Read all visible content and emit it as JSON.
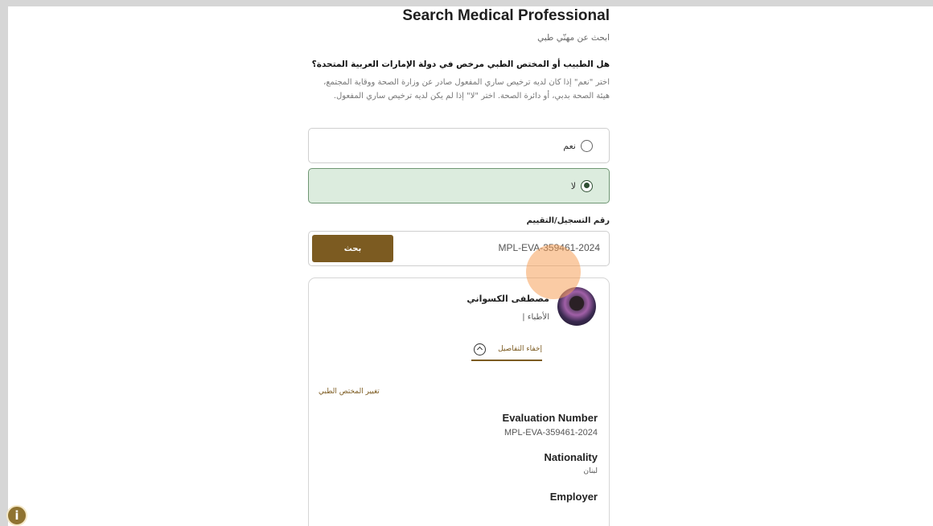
{
  "header": {
    "title": "Search Medical Professional",
    "subtitle": "ابحث عن مهنّي طبي"
  },
  "licensed_question": {
    "question": "هل الطبيب أو المختص الطبي مرخص في دولة الإمارات العربية المتحدة؟",
    "description": "اختر \"نعم\" إذا كان لديه ترخيص ساري المفعول صادر عن وزارة الصحة ووقاية المجتمع، هيئة الصحة بدبي، أو دائرة الصحة. اختر \"لا\" إذا لم يكن لديه ترخيص ساري المفعول.",
    "options": [
      {
        "label": "نعم",
        "selected": false
      },
      {
        "label": "لا",
        "selected": true
      }
    ]
  },
  "registration": {
    "label": "رقم التسجيل/التقييم",
    "value": "MPL-EVA-359461-2024",
    "search_button": "بحث"
  },
  "result": {
    "avatar_icon": "doctor-avatar",
    "name": "مصطفى الكسواني",
    "specialty": "الأطباء |",
    "toggle_label": "إخفاء التفاصيل",
    "toggle_icon": "chevron-up-icon",
    "change_link": "تغيير المختص الطبي",
    "fields": [
      {
        "label": "Evaluation Number",
        "value": "MPL-EVA-359461-2024"
      },
      {
        "label": "Nationality",
        "value": "لبنان"
      },
      {
        "label": "Employer",
        "value": ""
      }
    ]
  },
  "colors": {
    "accent": "#7c5b21",
    "selected_option_bg": "#dcecde",
    "cursor_highlight": "#f5a05a"
  },
  "help_button": {
    "icon": "accessibility-icon",
    "glyph": "i"
  }
}
